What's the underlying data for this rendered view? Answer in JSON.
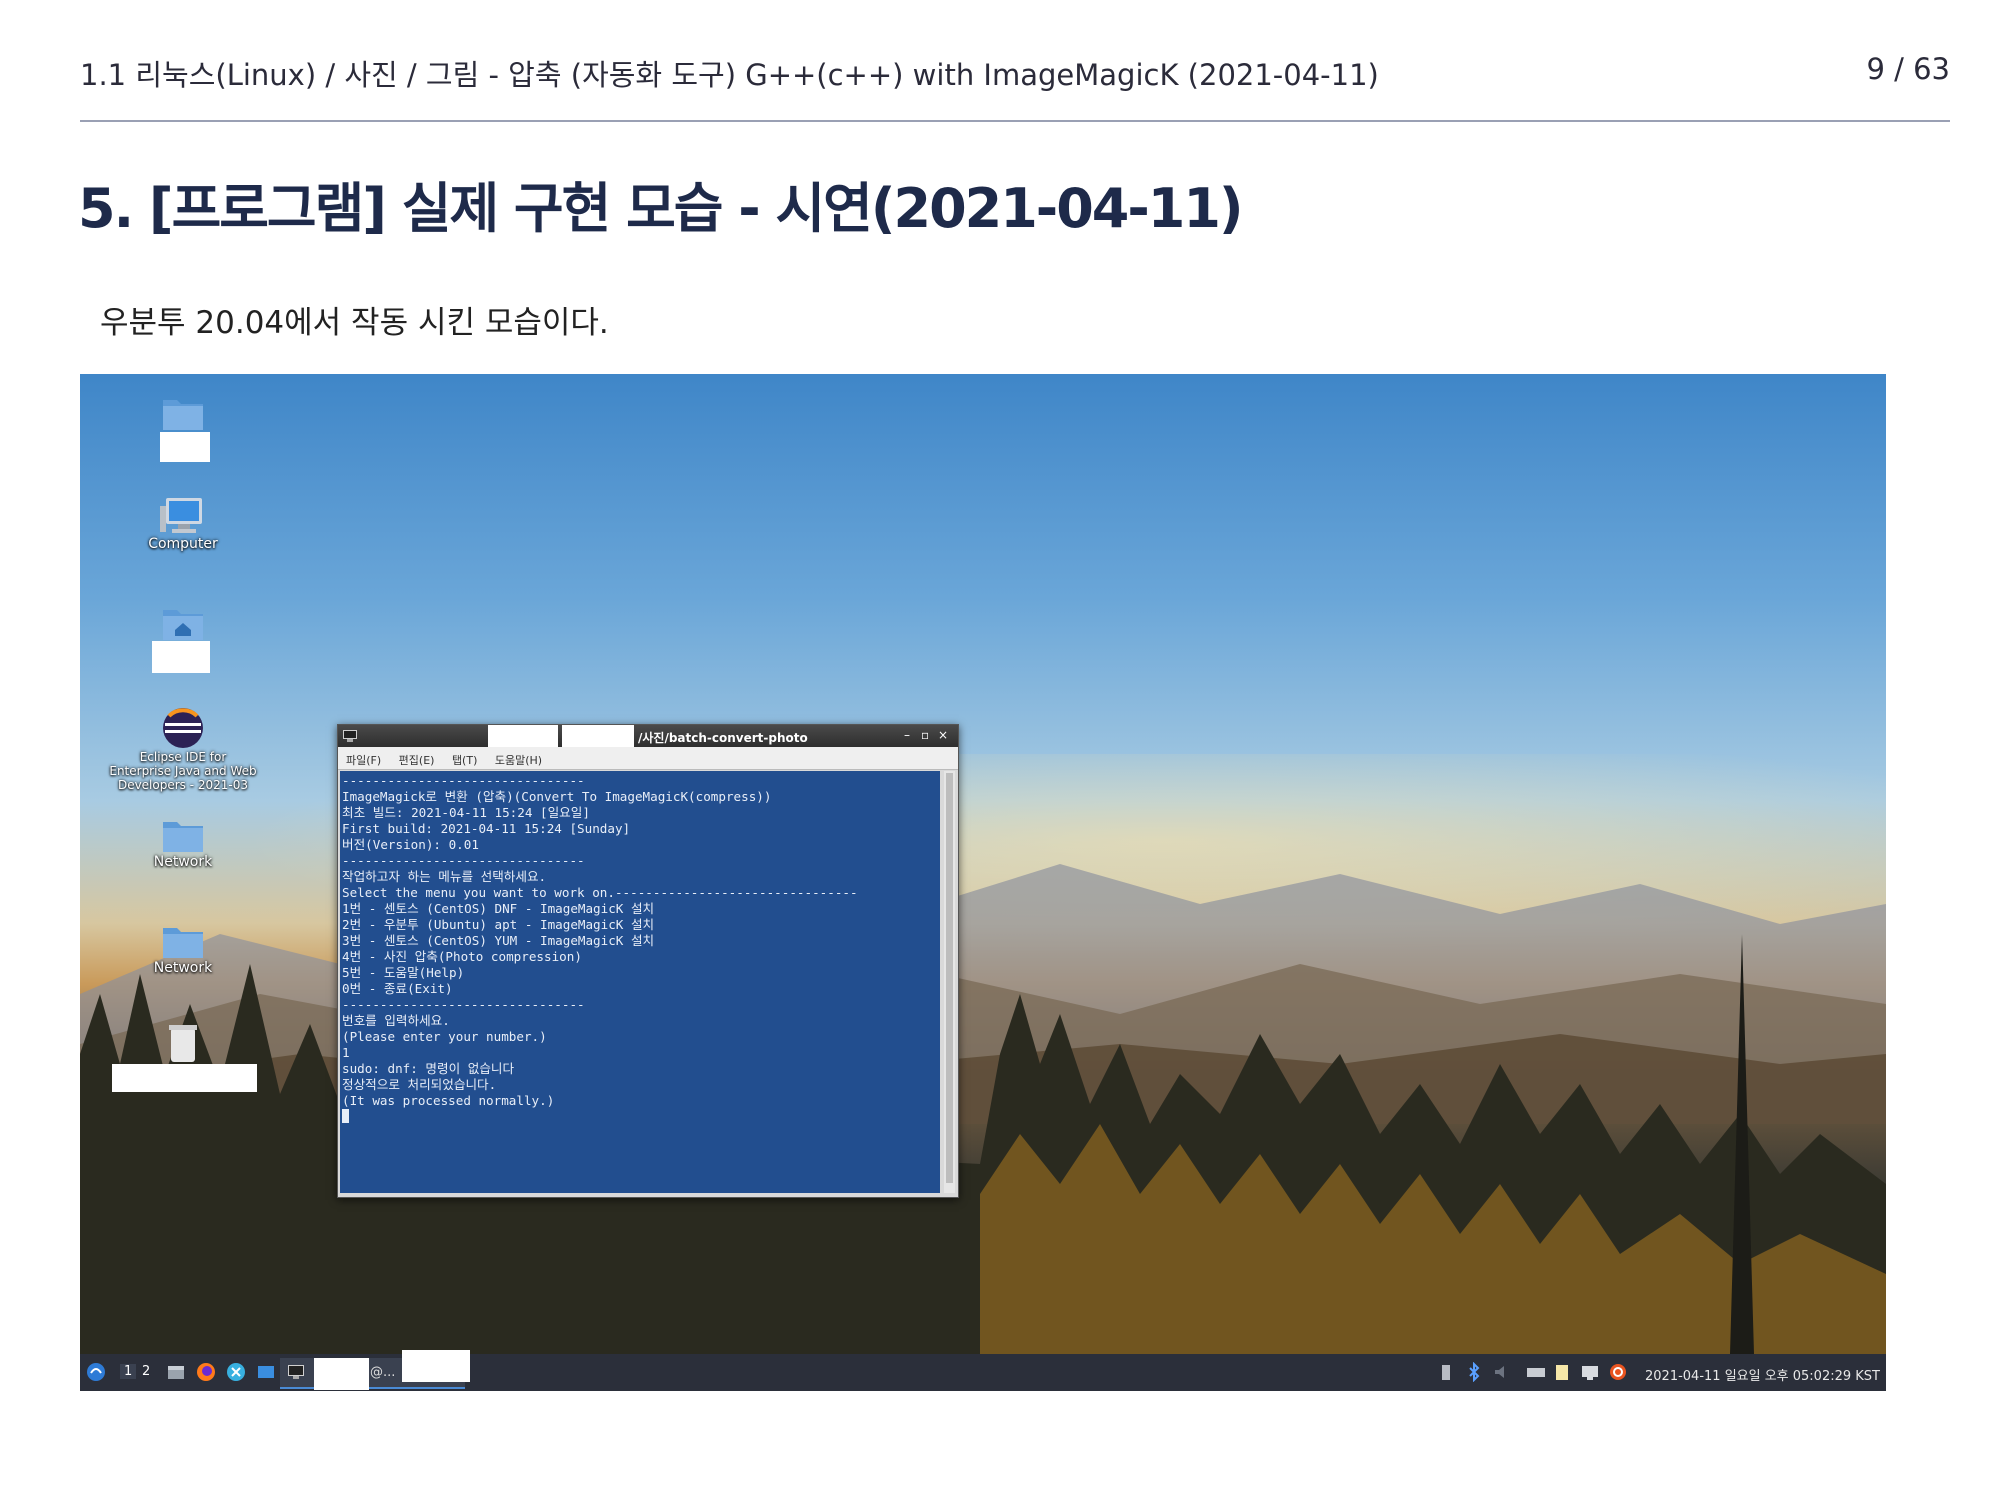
{
  "header": {
    "breadcrumb": "1.1 리눅스(Linux) / 사진 / 그림 - 압축 (자동화 도구) G++(c++) with ImageMagicK (2021-04-11)",
    "page": "9 / 63"
  },
  "section": {
    "title": "5. [프로그램] 실제 구현 모습 - 시연(2021-04-11)",
    "intro": "우분투 20.04에서 작동 시킨 모습이다."
  },
  "desktop": {
    "icons": [
      {
        "name": "folder-icon",
        "label": ""
      },
      {
        "name": "computer-icon",
        "label": "Computer"
      },
      {
        "name": "home-folder-icon",
        "label": ""
      },
      {
        "name": "eclipse-icon",
        "label": "Eclipse IDE for Enterprise Java and Web Developers - 2021-03"
      },
      {
        "name": "network-icon",
        "label": "Network"
      },
      {
        "name": "network-icon",
        "label": "Network"
      },
      {
        "name": "trash-icon",
        "label": ""
      }
    ]
  },
  "terminal": {
    "title": "/사진/batch-convert-photo",
    "controls": [
      "–",
      "▫",
      "×"
    ],
    "menu": [
      "파일(F)",
      "편집(E)",
      "탭(T)",
      "도움말(H)"
    ],
    "lines": [
      "--------------------------------",
      "ImageMagick로 변환 (압축)(Convert To ImageMagicK(compress))",
      "최초 빌드: 2021-04-11 15:24 [일요일]",
      "First build: 2021-04-11 15:24 [Sunday]",
      "버전(Version): 0.01",
      "--------------------------------",
      "작업하고자 하는 메뉴를 선택하세요.",
      "Select the menu you want to work on.--------------------------------",
      "1번 - 센토스 (CentOS) DNF - ImageMagicK 설치",
      "2번 - 우분투 (Ubuntu) apt - ImageMagicK 설치",
      "3번 - 센토스 (CentOS) YUM - ImageMagicK 설치",
      "4번 - 사진 압축(Photo compression)",
      "5번 - 도움말(Help)",
      "0번 - 종료(Exit)",
      "--------------------------------",
      "번호를 입력하세요.",
      "(Please enter your number.)",
      "1",
      "sudo: dnf: 명령이 없습니다",
      "정상적으로 처리되었습니다.",
      "(It was processed normally.)"
    ]
  },
  "taskbar": {
    "workspaces": [
      "1",
      "2"
    ],
    "task_label": "@...",
    "clock": "2021-04-11 일요일 오후 05:02:29 KST"
  },
  "colors": {
    "title": "#1e2a4a",
    "terminal_bg": "#224e8f",
    "taskbar_bg": "#2b2f3a"
  }
}
